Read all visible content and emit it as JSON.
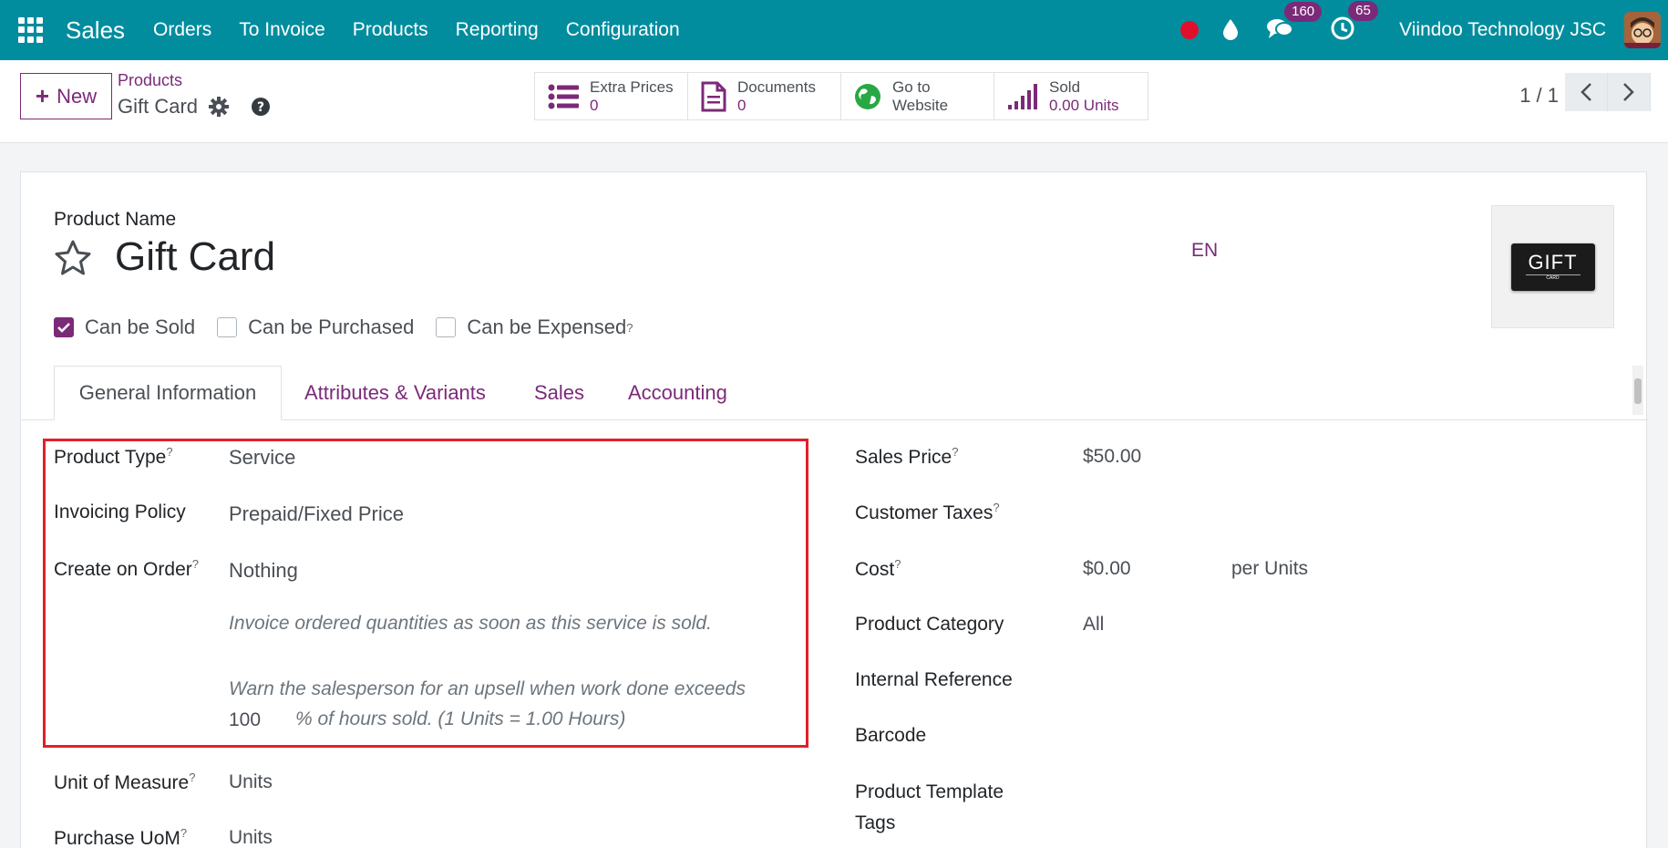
{
  "navbar": {
    "app_name": "Sales",
    "menu": [
      "Orders",
      "To Invoice",
      "Products",
      "Reporting",
      "Configuration"
    ],
    "messages_count": "160",
    "activities_count": "65",
    "company": "Viindoo Technology JSC",
    "bg_color": "#018d9e"
  },
  "control": {
    "new_label": "New",
    "breadcrumb": "Products",
    "record": "Gift Card",
    "smart_buttons": [
      {
        "label": "Extra Prices",
        "value": "0",
        "icon": "list-icon"
      },
      {
        "label": "Documents",
        "value": "0",
        "icon": "document-icon"
      },
      {
        "label": "Go to",
        "value": "Website",
        "icon": "globe-icon"
      },
      {
        "label": "Sold",
        "value": "0.00 Units",
        "icon": "signal-bars-icon"
      }
    ],
    "pager": "1 / 1"
  },
  "form": {
    "product_name_label": "Product Name",
    "product_name": "Gift Card",
    "lang": "EN",
    "image_text": "GIFT",
    "image_subtext": "CARD",
    "checks": [
      {
        "label": "Can be Sold",
        "checked": true
      },
      {
        "label": "Can be Purchased",
        "checked": false
      },
      {
        "label": "Can be Expensed",
        "checked": false
      }
    ],
    "tabs": [
      "General Information",
      "Attributes & Variants",
      "Sales",
      "Accounting"
    ],
    "left_fields": {
      "product_type_label": "Product Type",
      "product_type": "Service",
      "invoicing_policy_label": "Invoicing Policy",
      "invoicing_policy": "Prepaid/Fixed Price",
      "create_on_order_label": "Create on Order",
      "create_on_order": "Nothing",
      "hint_invoice": "Invoice ordered quantities as soon as this service is sold.",
      "hint_upsell": "Warn the salesperson for an upsell when work done exceeds",
      "upsell_value": "100",
      "hint_upsell_tail": "% of hours sold. (1 Units = 1.00 Hours)",
      "uom_label": "Unit of Measure",
      "uom": "Units",
      "purchase_uom_label": "Purchase UoM",
      "purchase_uom": "Units"
    },
    "right_fields": {
      "sales_price_label": "Sales Price",
      "sales_price": "$50.00",
      "customer_taxes_label": "Customer Taxes",
      "cost_label": "Cost",
      "cost": "$0.00",
      "cost_unit": "per Units",
      "category_label": "Product Category",
      "category": "All",
      "internal_ref_label": "Internal Reference",
      "barcode_label": "Barcode",
      "tags_label_line1": "Product Template",
      "tags_label_line2": "Tags"
    }
  },
  "accent_color": "#7b2a78",
  "highlight_color": "#e0202a"
}
